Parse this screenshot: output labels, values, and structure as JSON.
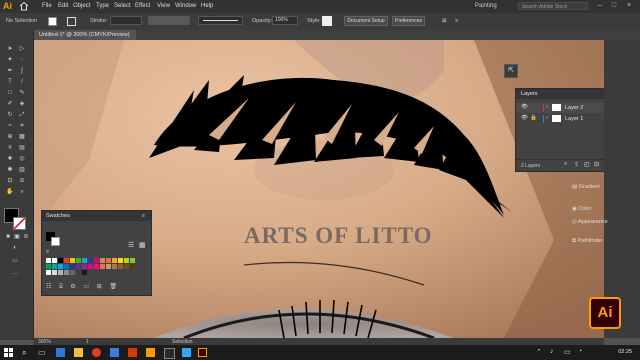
{
  "app": {
    "logo": "Ai"
  },
  "menu": [
    "File",
    "Edit",
    "Object",
    "Type",
    "Select",
    "Effect",
    "View",
    "Window",
    "Help"
  ],
  "workspace": "Painting",
  "search_placeholder": "Search Adobe Stock",
  "control": {
    "selection_label": "No Selection",
    "stroke_label": "Stroke:",
    "opacity_label": "Opacity:",
    "opacity_value": "100%",
    "style_label": "Style:",
    "document_setup": "Document Setup",
    "preferences": "Preferences"
  },
  "document_tab": "Untitled-1* @ 300% (CMYK/Preview)",
  "artwork_text": "ARTS OF LITTO",
  "swatches": {
    "title": "Swatches"
  },
  "layers": {
    "title": "Layers",
    "items": [
      {
        "name": "Layer 2"
      },
      {
        "name": "Layer 1"
      }
    ],
    "count": "2 Layers"
  },
  "dock": {
    "gradient": "Gradient",
    "color": "Color",
    "appearance": "Appearance",
    "pathfinder": "Pathfinder"
  },
  "status": {
    "zoom": "300%",
    "page": "1",
    "tool": "Selection"
  },
  "badge": "Ai",
  "clock": "02:25",
  "colors": {
    "accent": "#ff9a00",
    "panel": "#424242",
    "layer_color": "#d63b3b"
  }
}
